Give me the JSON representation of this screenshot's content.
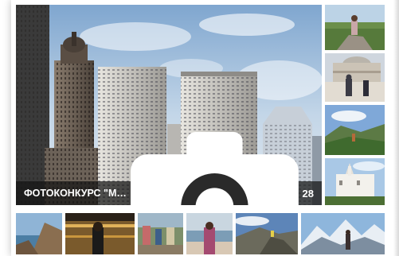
{
  "contest": {
    "title": "ФОТОКОНКУРС \"Моё турист...",
    "photo_count": "28",
    "count_icon": "camera-icon"
  },
  "colors": {
    "caption_bg": "#141414",
    "caption_text": "#ffffff",
    "sky": "#a9c3dd"
  },
  "thumbnails_right": [
    {
      "name": "thumb-person-on-rock"
    },
    {
      "name": "thumb-mosque-courtyard"
    },
    {
      "name": "thumb-mountain-meadow"
    },
    {
      "name": "thumb-white-palace"
    }
  ],
  "thumbnails_bottom": [
    {
      "name": "thumb-coastal-cliffs"
    },
    {
      "name": "thumb-monument-night"
    },
    {
      "name": "thumb-family-outdoors"
    },
    {
      "name": "thumb-woman-by-sea"
    },
    {
      "name": "thumb-rocky-mountain"
    },
    {
      "name": "thumb-snowy-peaks"
    }
  ]
}
